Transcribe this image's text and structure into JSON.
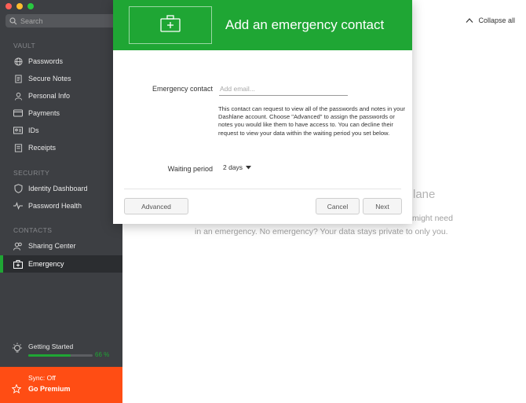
{
  "search": {
    "placeholder": "Search"
  },
  "sidebar": {
    "sections": {
      "vault": "VAULT",
      "security": "SECURITY",
      "contacts": "CONTACTS"
    },
    "items": [
      {
        "label": "Passwords",
        "icon": "globe-icon"
      },
      {
        "label": "Secure Notes",
        "icon": "note-icon"
      },
      {
        "label": "Personal Info",
        "icon": "person-icon"
      },
      {
        "label": "Payments",
        "icon": "card-icon"
      },
      {
        "label": "IDs",
        "icon": "id-card-icon"
      },
      {
        "label": "Receipts",
        "icon": "receipt-icon"
      },
      {
        "label": "Identity Dashboard",
        "icon": "shield-icon"
      },
      {
        "label": "Password Health",
        "icon": "pulse-icon"
      },
      {
        "label": "Sharing Center",
        "icon": "people-icon"
      },
      {
        "label": "Emergency",
        "icon": "first-aid-kit-icon"
      }
    ],
    "getting_started": {
      "label": "Getting Started",
      "percent_text": "66 %",
      "progress": 0.66
    },
    "premium": {
      "sync": "Sync: Off",
      "go": "Go Premium"
    }
  },
  "main": {
    "collapse_label": "Collapse all",
    "bg_heading": "lane",
    "bg_line1": "might need",
    "bg_line2": "in an emergency. No emergency? Your data stays private to only you."
  },
  "modal": {
    "title": "Add an emergency contact",
    "contact_label": "Emergency contact",
    "email_placeholder": "Add email...",
    "help_text": "This contact can request to view all of the passwords and notes in your Dashlane account. Choose \"Advanced\" to assign the passwords or notes you would like them to have access to. You can decline their request to view your data within the waiting period you set below.",
    "waiting_label": "Waiting period",
    "waiting_value": "2 days",
    "buttons": {
      "advanced": "Advanced",
      "cancel": "Cancel",
      "next": "Next"
    }
  },
  "colors": {
    "accent": "#1fa634",
    "sidebar": "#3d3f43",
    "premium": "#ff4d14"
  }
}
